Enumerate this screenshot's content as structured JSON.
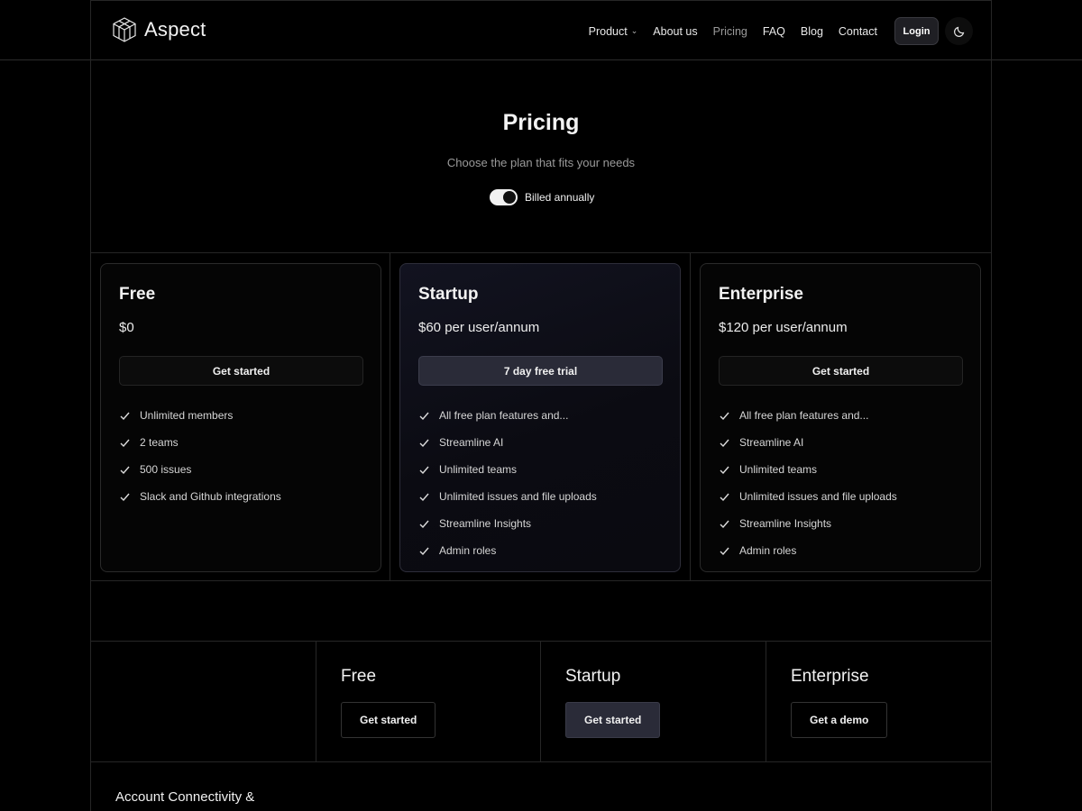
{
  "nav": {
    "brand": "Aspect",
    "links": [
      {
        "label": "Product",
        "has_dropdown": true
      },
      {
        "label": "About us"
      },
      {
        "label": "Pricing",
        "active": true
      },
      {
        "label": "FAQ"
      },
      {
        "label": "Blog"
      },
      {
        "label": "Contact"
      }
    ],
    "login_label": "Login",
    "theme_icon": "moon-icon"
  },
  "hero": {
    "title": "Pricing",
    "subtitle": "Choose the plan that fits your needs",
    "billing_label": "Billed annually",
    "billing_toggle_on": true
  },
  "plans": [
    {
      "name": "Free",
      "price": "$0",
      "button": "Get started",
      "features": [
        "Unlimited members",
        "2 teams",
        "500 issues",
        "Slack and Github integrations"
      ]
    },
    {
      "name": "Startup",
      "price": "$60 per user/annum",
      "button": "7 day free trial",
      "features": [
        "All free plan features and...",
        "Streamline AI",
        "Unlimited teams",
        "Unlimited issues and file uploads",
        "Streamline Insights",
        "Admin roles"
      ]
    },
    {
      "name": "Enterprise",
      "price": "$120 per user/annum",
      "button": "Get started",
      "features": [
        "All free plan features and...",
        "Streamline AI",
        "Unlimited teams",
        "Unlimited issues and file uploads",
        "Streamline Insights",
        "Admin roles"
      ]
    }
  ],
  "compare": {
    "columns": [
      {
        "name": "Free",
        "button": "Get started"
      },
      {
        "name": "Startup",
        "button": "Get started"
      },
      {
        "name": "Enterprise",
        "button": "Get a demo"
      }
    ]
  },
  "section_title": "Account Connectivity &",
  "colors": {
    "background": "#000000",
    "accent_button": "#2a2b38",
    "border": "#262626"
  }
}
